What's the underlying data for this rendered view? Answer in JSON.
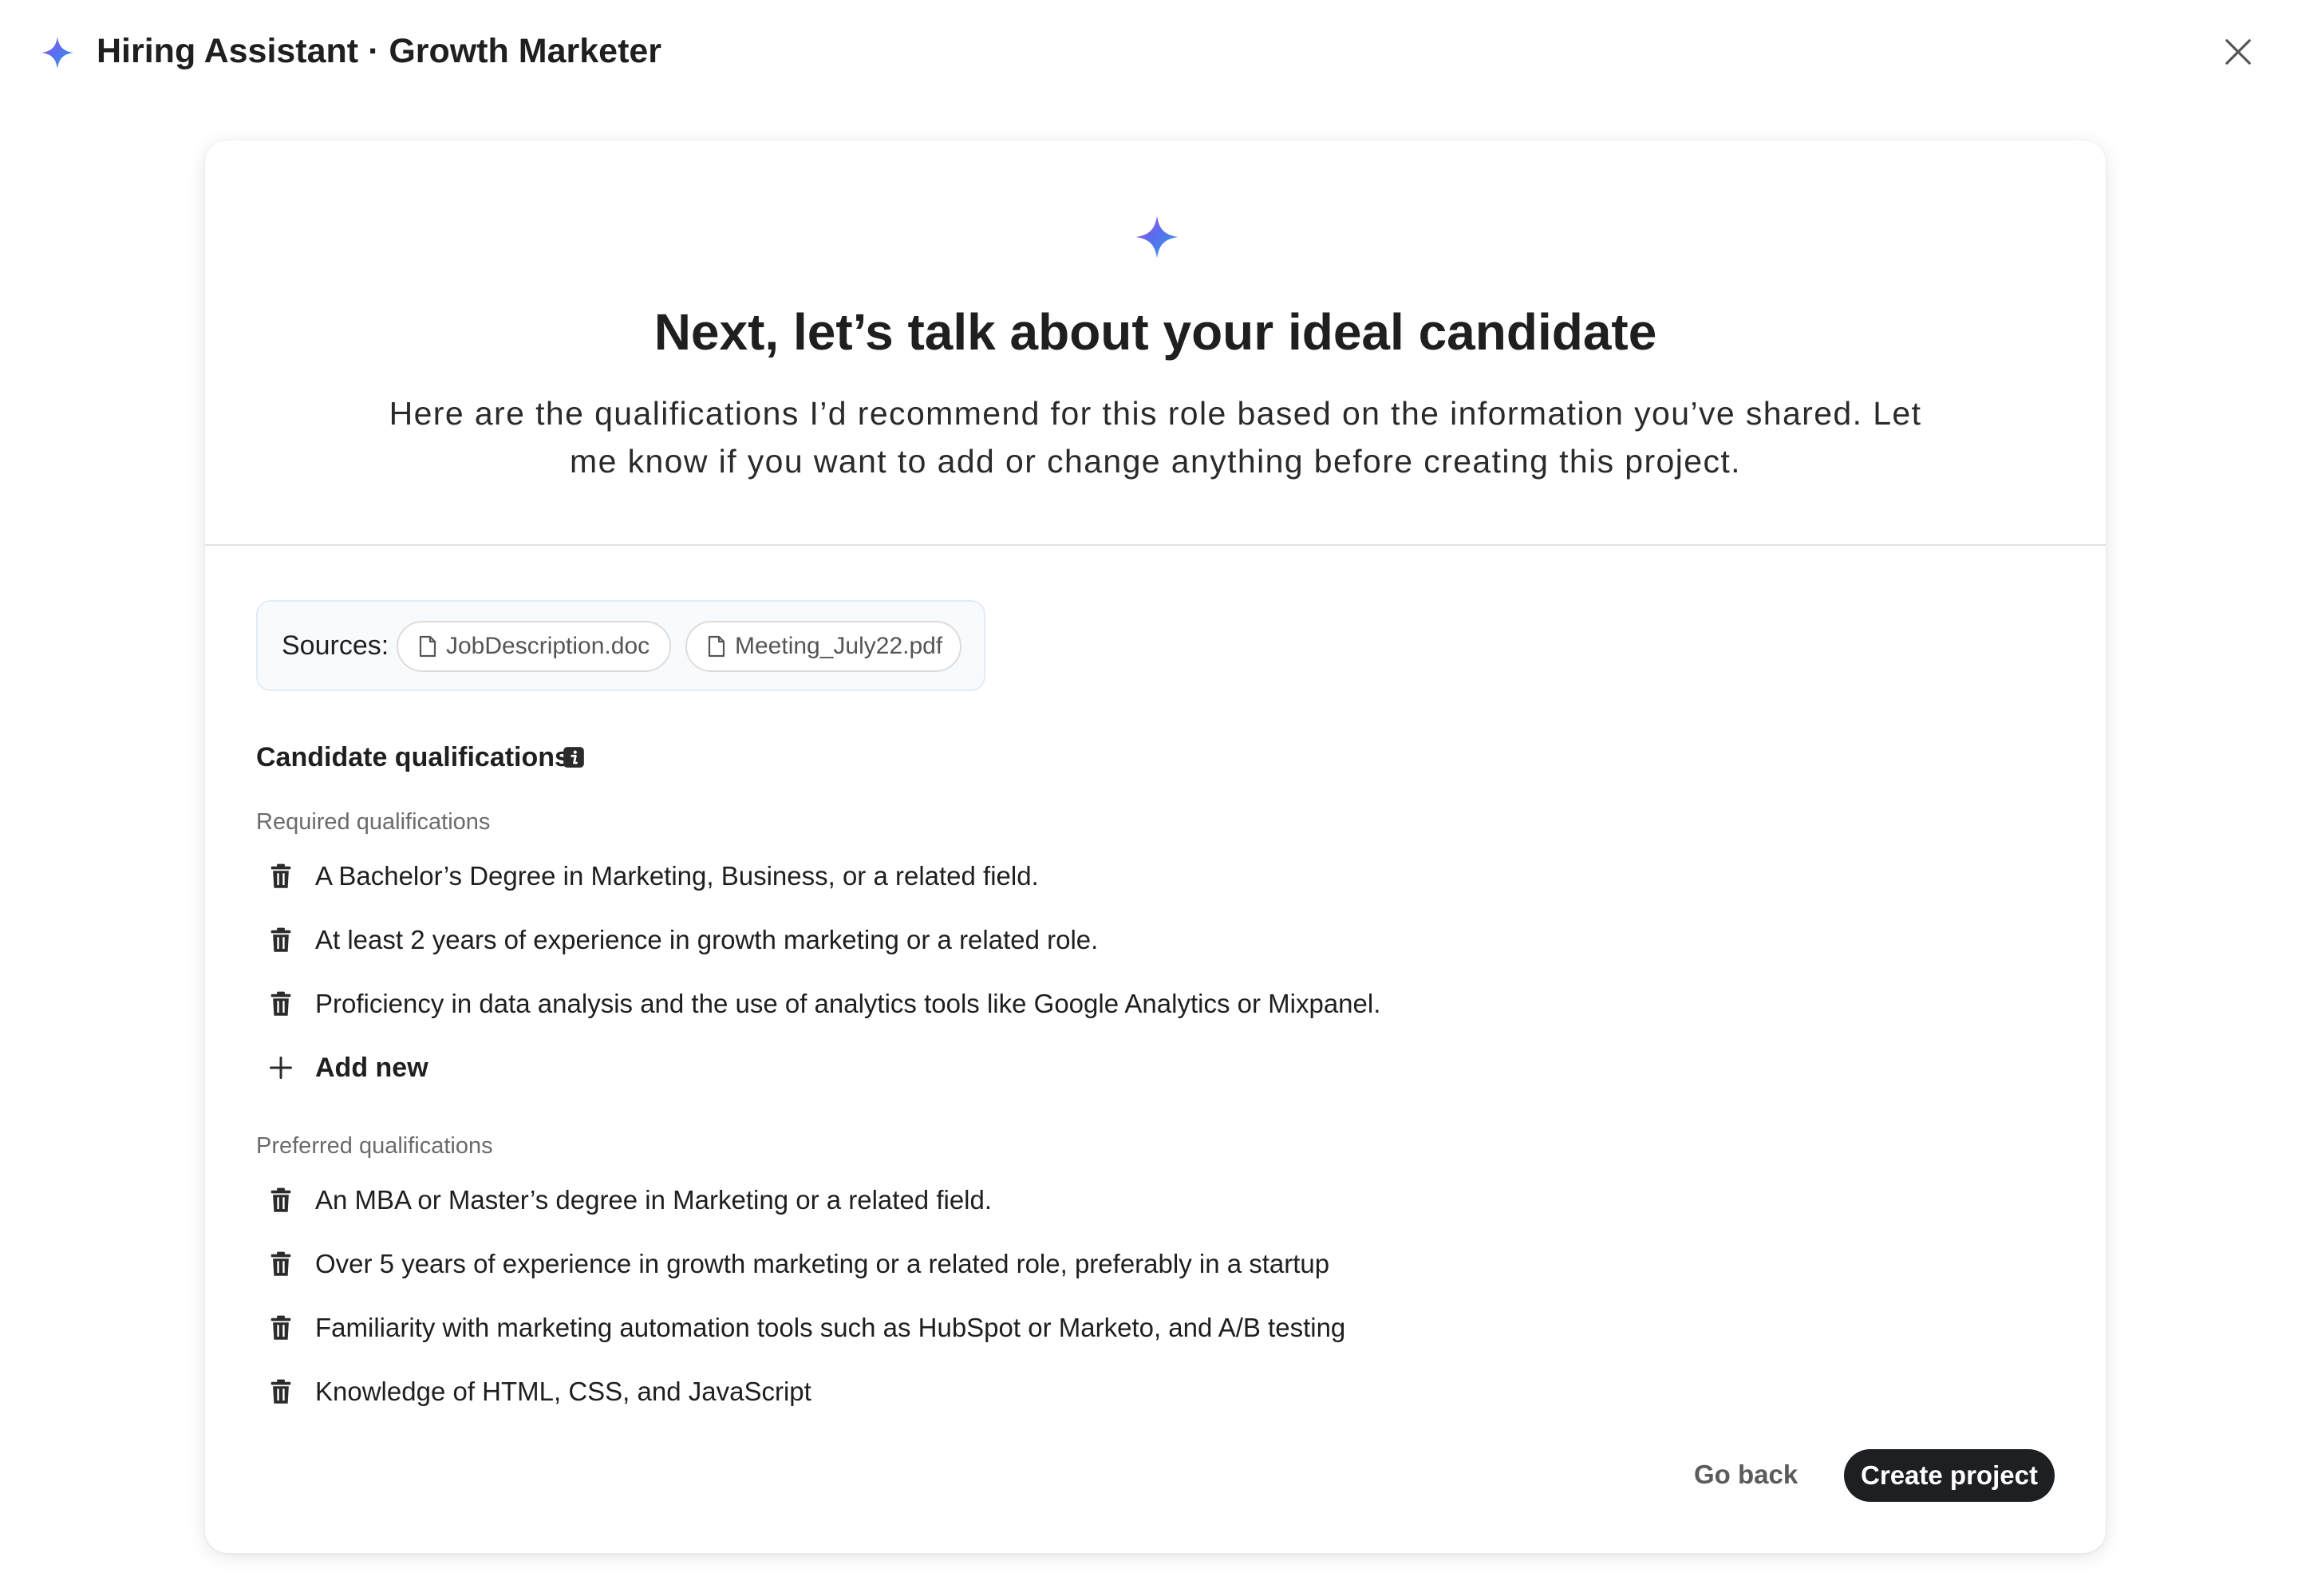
{
  "header": {
    "title": "Hiring Assistant · Growth Marketer",
    "spark_icon": "sparkle-icon",
    "close_icon": "close-icon"
  },
  "card": {
    "headline": "Next, let’s talk about your ideal candidate",
    "intro": "Here are the qualifications I’d recommend for this role based on the information you’ve shared. Let me know if you want to add or change anything before creating this project.",
    "sources": {
      "label": "Sources:",
      "files": [
        "JobDescription.doc",
        "Meeting_July22.pdf"
      ]
    },
    "qualifications": {
      "title": "Candidate qualifications",
      "required": {
        "label": "Required qualifications",
        "items": [
          "A Bachelor’s Degree in Marketing, Business, or a related field.",
          "At least 2 years of experience in growth marketing or a related role.",
          "Proficiency in data analysis and the use of analytics tools like Google Analytics or Mixpanel."
        ],
        "add_label": "Add new"
      },
      "preferred": {
        "label": "Preferred qualifications",
        "items": [
          "An MBA or Master’s degree in Marketing or a related field.",
          "Over 5 years of experience in growth marketing or a related role, preferably in a startup",
          "Familiarity with marketing automation tools such as HubSpot or Marketo, and A/B testing",
          "Knowledge of HTML, CSS, and JavaScript"
        ]
      }
    },
    "actions": {
      "back_label": "Go back",
      "create_label": "Create project"
    }
  },
  "colors": {
    "primary_button": "#1d1f22",
    "spark_blue": "#2f6fe4",
    "spark_purple": "#9a4fd6",
    "spark_cyan": "#3fb6e8"
  }
}
